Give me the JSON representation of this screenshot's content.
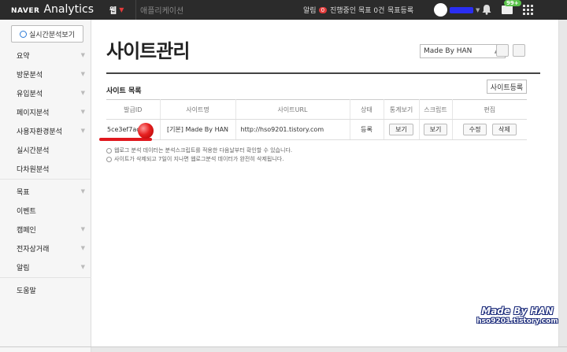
{
  "topbar": {
    "naver": "NAVER",
    "analytics": "Analytics",
    "tab_web": "웹",
    "tab_app": "애플리케이션",
    "alert_label": "알림",
    "alert_count": "0",
    "goal_status": "진행중인 목표 0건",
    "goal_register": "목표등록",
    "mail_badge": "99+"
  },
  "sidebar": {
    "realtime_button": "실시간분석보기",
    "items": [
      {
        "label": "요약",
        "arrow": true
      },
      {
        "label": "방문분석",
        "arrow": true
      },
      {
        "label": "유입분석",
        "arrow": true
      },
      {
        "label": "페이지분석",
        "arrow": true
      },
      {
        "label": "사용자환경분석",
        "arrow": true
      },
      {
        "label": "실시간분석",
        "arrow": false
      },
      {
        "label": "다차원분석",
        "arrow": false
      },
      {
        "label": "목표",
        "arrow": true
      },
      {
        "label": "이벤트",
        "arrow": false
      },
      {
        "label": "캠페인",
        "arrow": true
      },
      {
        "label": "전자상거래",
        "arrow": true
      },
      {
        "label": "알림",
        "arrow": true
      },
      {
        "label": "도움말",
        "arrow": false
      }
    ]
  },
  "main": {
    "title": "사이트관리",
    "site_select": "Made By HAN",
    "section_title": "사이트 목록",
    "register_button": "사이트등록",
    "columns": [
      "발급ID",
      "사이트명",
      "사이트URL",
      "상태",
      "통계보기",
      "스크립트",
      "편집"
    ],
    "rows": [
      {
        "id": "5ce3ef7ac9",
        "name": "[기본] Made By HAN",
        "url": "http://hso9201.tistory.com",
        "status": "등록",
        "stats_btn": "보기",
        "script_btn": "보기",
        "edit_btn": "수정",
        "delete_btn": "삭제"
      }
    ],
    "notes": [
      "웹로그 분석 데이터는 분석스크립트를 적용한 다음날부터 확인할 수 있습니다.",
      "사이트가 삭제되고 7일이 지나면 웹로그분석 데이터가 완전히 삭제됩니다."
    ]
  },
  "watermark": {
    "line1": "Made By HAN",
    "line2": "hso9201.tistory.com"
  },
  "colors": {
    "topbar_bg": "#2b2b2b",
    "accent_red": "#e23b3b",
    "mail_badge_green": "#5ac34a"
  }
}
